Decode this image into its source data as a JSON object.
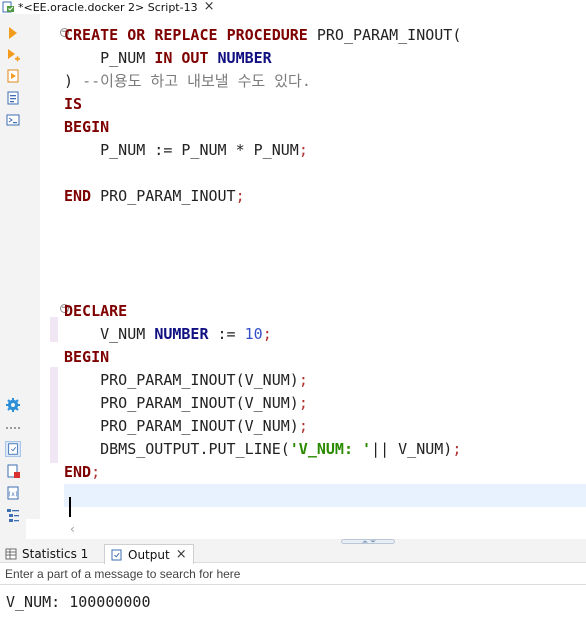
{
  "editor_tab": {
    "title": "*<EE.oracle.docker 2> Script-13",
    "icon": "sql-script-icon",
    "close_glyph": "×"
  },
  "left_toolbar": {
    "buttons": [
      "execute-statement-icon",
      "execute-script-icon",
      "execute-in-new-tab-icon",
      "explain-plan-icon",
      "open-console-icon",
      "settings-gear-icon",
      "active-script-icon",
      "error-script-icon",
      "variables-icon",
      "outline-icon"
    ]
  },
  "code": {
    "l1": [
      "CREATE",
      "OR",
      "REPLACE",
      "PROCEDURE",
      "PRO_PARAM_INOUT("
    ],
    "l2": [
      "P_NUM",
      "IN",
      "OUT",
      "NUMBER"
    ],
    "l3": [
      ")",
      "--이용도 하고 내보낼 수도 있다."
    ],
    "l4": "IS",
    "l5": "BEGIN",
    "l6": [
      "P_NUM := P_NUM * P_NUM",
      ";"
    ],
    "l8": [
      "END",
      "PRO_PARAM_INOUT",
      ";"
    ],
    "l13": "DECLARE",
    "l14": [
      "V_NUM",
      "NUMBER",
      ":=",
      "10",
      ";"
    ],
    "l15": "BEGIN",
    "l16": [
      "PRO_PARAM_INOUT(V_NUM)",
      ";"
    ],
    "l17": [
      "PRO_PARAM_INOUT(V_NUM)",
      ";"
    ],
    "l18": [
      "PRO_PARAM_INOUT(V_NUM)",
      ";"
    ],
    "l19": [
      "DBMS_OUTPUT.PUT_LINE(",
      "'V_NUM: '",
      "|| V_NUM)",
      ";"
    ],
    "l20": [
      "END",
      ";"
    ]
  },
  "bottom_panel": {
    "tabs": [
      {
        "label": "Statistics 1",
        "icon": "statistics-icon"
      },
      {
        "label": "Output",
        "icon": "output-icon",
        "close_glyph": "×"
      }
    ],
    "filter_placeholder": "Enter a part of a message to search for here",
    "output": "V_NUM: 100000000"
  },
  "colors": {
    "keyword": "#7f0000",
    "type_keyword": "#101083",
    "comment": "#7b7b7b",
    "number": "#3350c8",
    "string": "#2a8a00",
    "current_line": "#e8f2fe"
  }
}
